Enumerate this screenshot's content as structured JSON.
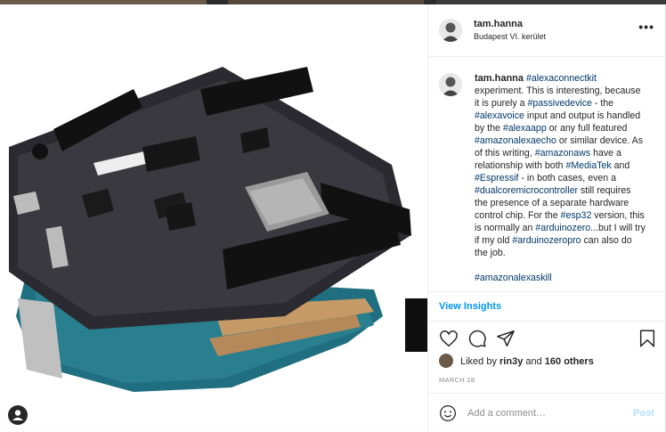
{
  "post": {
    "username": "tam.hanna",
    "location": "Budapest VI. kerület",
    "more_label": "•••"
  },
  "caption": {
    "username": "tam.hanna",
    "segments": [
      {
        "type": "tag",
        "text": "#alexaconnectkit"
      },
      {
        "type": "text",
        "text": " experiment. This is interesting, because it is purely a "
      },
      {
        "type": "tag",
        "text": "#passivedevice"
      },
      {
        "type": "text",
        "text": " - the "
      },
      {
        "type": "tag",
        "text": "#alexavoice"
      },
      {
        "type": "text",
        "text": " input and output is handled by the "
      },
      {
        "type": "tag",
        "text": "#alexaapp"
      },
      {
        "type": "text",
        "text": " or any full featured "
      },
      {
        "type": "tag",
        "text": "#amazonalexaecho"
      },
      {
        "type": "text",
        "text": " or similar device. As of this writing, "
      },
      {
        "type": "tag",
        "text": "#amazonaws"
      },
      {
        "type": "text",
        "text": " have a relationship with both "
      },
      {
        "type": "tag",
        "text": "#MediaTek"
      },
      {
        "type": "text",
        "text": " and "
      },
      {
        "type": "tag",
        "text": "#Espressif"
      },
      {
        "type": "text",
        "text": " - in both cases, even a "
      },
      {
        "type": "tag",
        "text": "#dualcoremicrocontroller"
      },
      {
        "type": "text",
        "text": " still requires the presence of a separate hardware control chip. For the "
      },
      {
        "type": "tag",
        "text": "#esp32"
      },
      {
        "type": "text",
        "text": " version, this is normally an "
      },
      {
        "type": "tag",
        "text": "#arduinozero"
      },
      {
        "type": "text",
        "text": "...but I will try if my old "
      },
      {
        "type": "tag",
        "text": "#arduinozeropro"
      },
      {
        "type": "text",
        "text": " can also do the job."
      },
      {
        "type": "break"
      },
      {
        "type": "break"
      },
      {
        "type": "tag",
        "text": "#amazonalexaskill"
      }
    ]
  },
  "insights_label": "View Insights",
  "likes": {
    "prefix": "Liked by ",
    "user": "rin3y",
    "middle": " and ",
    "others": "160 others"
  },
  "date": "MARCH 28",
  "comment": {
    "placeholder": "Add a comment…",
    "post_label": "Post"
  },
  "icons": {
    "like": "heart-icon",
    "comment": "comment-icon",
    "share": "paper-plane-icon",
    "save": "bookmark-icon",
    "emoji": "smiley-icon",
    "more": "more-dots-icon",
    "badge": "user-tag-icon"
  },
  "colors": {
    "link": "#00376b",
    "accent": "#0095f6",
    "post_disabled": "#b2dffc",
    "muted": "#8e8e8e"
  }
}
